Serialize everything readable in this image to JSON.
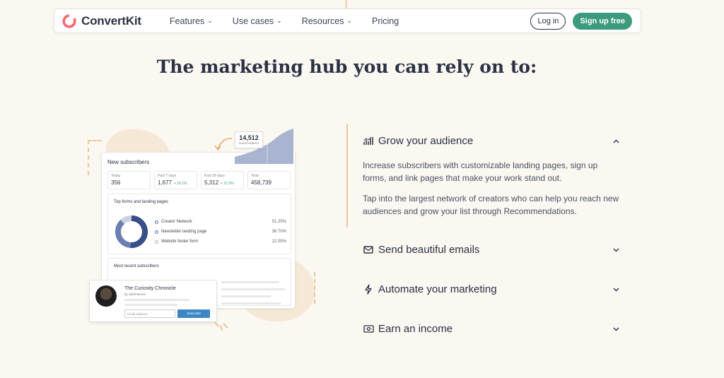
{
  "brand": {
    "name": "ConvertKit",
    "accent": "#fb6970"
  },
  "nav": {
    "items": [
      {
        "label": "Features",
        "dropdown": true
      },
      {
        "label": "Use cases",
        "dropdown": true
      },
      {
        "label": "Resources",
        "dropdown": true
      },
      {
        "label": "Pricing",
        "dropdown": false
      }
    ],
    "login_label": "Log in",
    "signup_label": "Sign up free",
    "signup_color": "#3d9b7d"
  },
  "headline": "The marketing hub you can rely on to:",
  "illustration": {
    "card_title": "New subscribers",
    "stats": [
      {
        "label": "Today",
        "value": "356",
        "delta": ""
      },
      {
        "label": "Past 7 days",
        "value": "1,677",
        "delta": "+ 16.1%"
      },
      {
        "label": "Past 30 days",
        "value": "5,312",
        "delta": "+ 21.9%"
      },
      {
        "label": "Total",
        "value": "458,739",
        "delta": ""
      }
    ],
    "forms_title": "Top forms and landing pages",
    "forms": [
      {
        "name": "Creator Network",
        "pct": "51.25%"
      },
      {
        "name": "Newsletter landing page",
        "pct": "36.70%"
      },
      {
        "name": "Website footer form",
        "pct": "12.05%"
      }
    ],
    "recent_title": "Most recent subscribers",
    "counter": {
      "value": "14,512",
      "label": "SUBSCRIBERS"
    },
    "form_card": {
      "title": "The Curiosity Chronicle",
      "byline": "by Sahil Bloom",
      "input_placeholder": "Email address",
      "button_label": "Subscribe"
    }
  },
  "accordion": {
    "items": [
      {
        "title": "Grow your audience",
        "icon": "bar-chart-icon",
        "expanded": true,
        "paragraphs": [
          "Increase subscribers with customizable landing pages, sign up forms, and link pages that make your work stand out.",
          "Tap into the largest network of creators who can help you reach new audiences and grow your list through Recommendations."
        ]
      },
      {
        "title": "Send beautiful emails",
        "icon": "envelope-icon",
        "expanded": false
      },
      {
        "title": "Automate your marketing",
        "icon": "lightning-icon",
        "expanded": false
      },
      {
        "title": "Earn an income",
        "icon": "money-icon",
        "expanded": false
      }
    ]
  }
}
